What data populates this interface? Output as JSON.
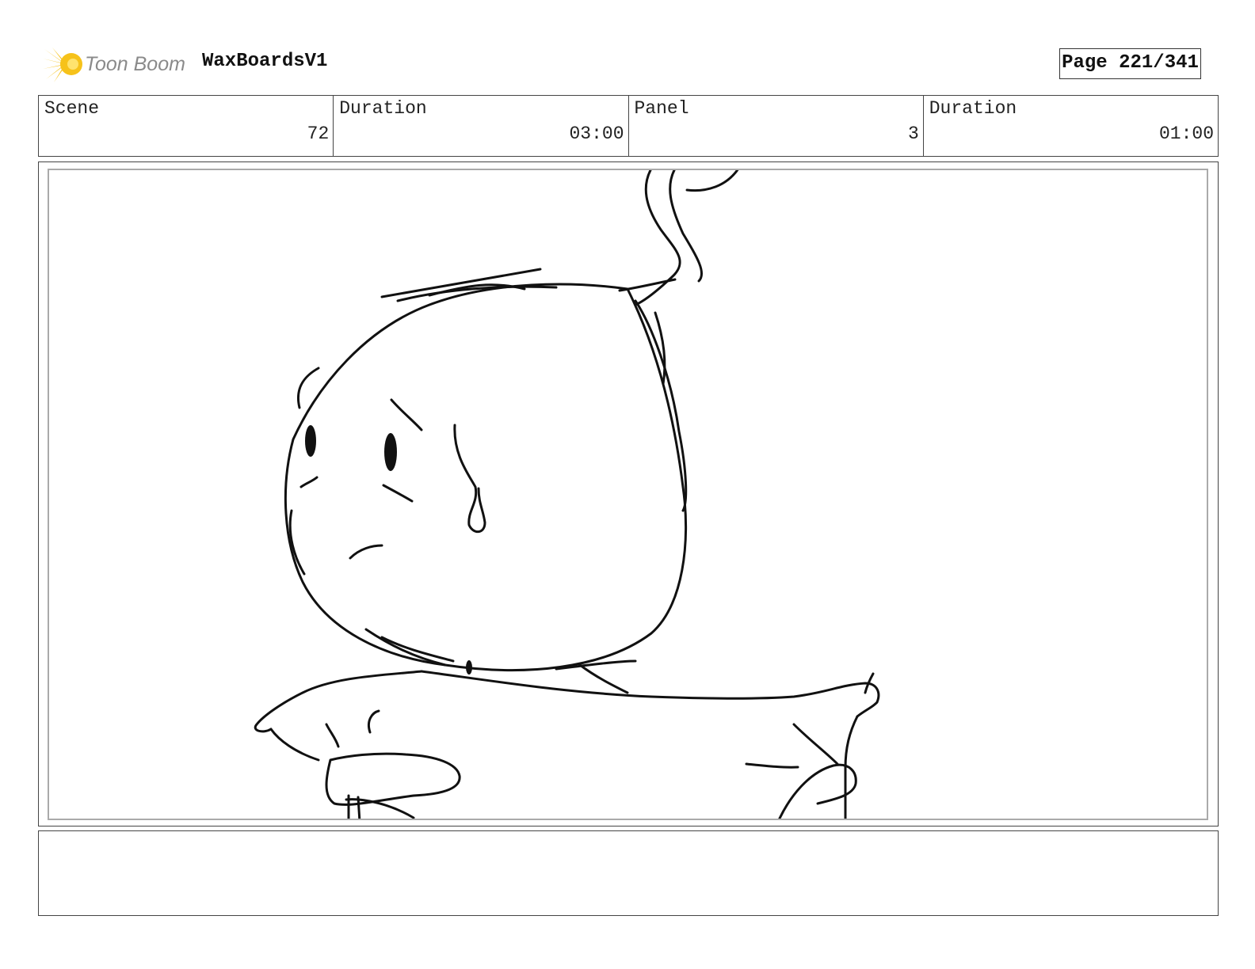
{
  "header": {
    "logo_text": "Toon Boom",
    "project_name": "WaxBoardsV1",
    "page_label": "Page 221/341"
  },
  "info": {
    "scene_label": "Scene",
    "scene_value": "72",
    "scene_duration_label": "Duration",
    "scene_duration_value": "03:00",
    "panel_label": "Panel",
    "panel_value": "3",
    "panel_duration_label": "Duration",
    "panel_duration_value": "01:00"
  },
  "notes": {
    "text": ""
  },
  "colors": {
    "logo_yellow": "#f6c21a",
    "logo_text_gray": "#8a8a8a",
    "frame_gray": "#aaaaaa"
  }
}
